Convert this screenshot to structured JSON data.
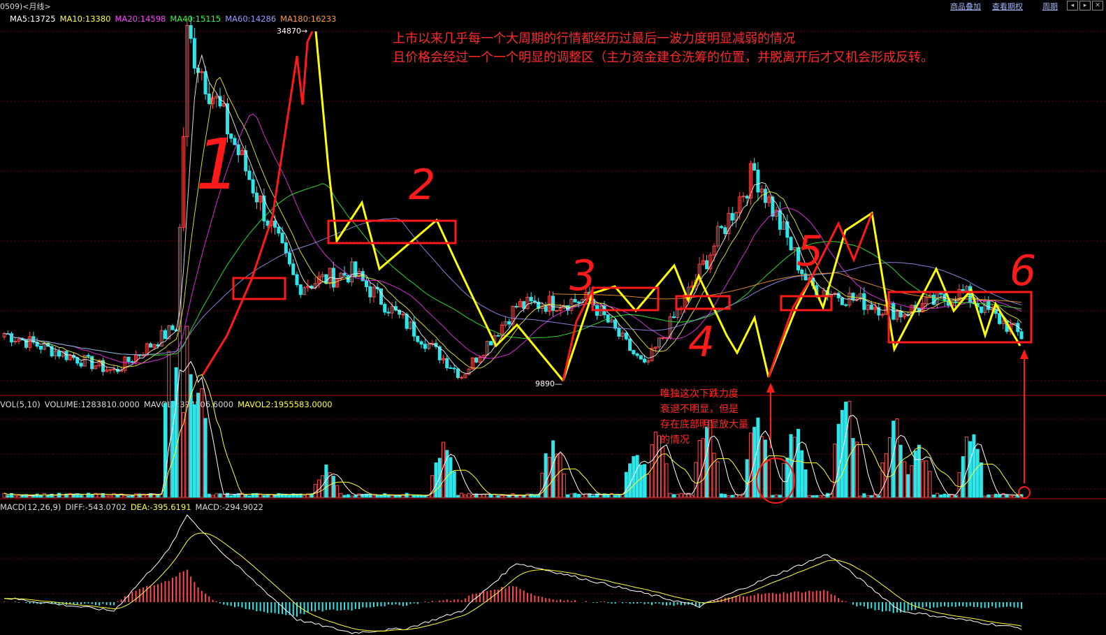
{
  "header": {
    "title": "0509)<月线>",
    "links": [
      "商品叠加",
      "查看期权",
      "周期"
    ]
  },
  "colors": {
    "up": "#ff4a4a",
    "down": "#2ee6ea",
    "ma5": "#ffffff",
    "ma10": "#ffff33",
    "ma20": "#ff33ff",
    "ma40": "#33ff33",
    "ma60": "#9a9aff",
    "ma180": "#ff9a33",
    "annot_red": "#ff1a1a",
    "annot_yellow": "#ffff00",
    "grid": "#6a0000"
  },
  "legend_main": [
    {
      "text": "MA5:13725",
      "color": "#ffffff"
    },
    {
      "text": "MA10:13380",
      "color": "#ffff33"
    },
    {
      "text": "MA20:14598",
      "color": "#ff44ff"
    },
    {
      "text": "MA40:15115",
      "color": "#33ff33"
    },
    {
      "text": "MA60:14286",
      "color": "#9a9aff"
    },
    {
      "text": "MA180:16233",
      "color": "#ff9a33"
    }
  ],
  "legend_vol": [
    {
      "text": "VOL(5,10)",
      "color": "#d8d8d8"
    },
    {
      "text": "VOLUME:1283810.0000",
      "color": "#d8d8d8"
    },
    {
      "text": "MAVOL1:394506.6000",
      "color": "#d8d8d8"
    },
    {
      "text": "MAVOL2:1955583.0000",
      "color": "#ffff33"
    }
  ],
  "legend_macd": [
    {
      "text": "MACD(12,26,9)",
      "color": "#d8d8d8"
    },
    {
      "text": "DIFF:-543.0702",
      "color": "#d8d8d8"
    },
    {
      "text": "DEA:-395.6191",
      "color": "#ffff33"
    },
    {
      "text": "MACD:-294.9022",
      "color": "#d8d8d8"
    }
  ],
  "annotations": {
    "note_main_1": "上市以来几乎每一个大周期的行情都经历过最后一波力度明显减弱的情况",
    "note_main_2": "且价格会经过一个一个明显的调整区（主力资金建仓洗筹的位置，并脱离开后才又机会形成反转。",
    "note_side": [
      "唯独这次下跌力度",
      "衰退不明显，但是",
      "存在底部明显放大量",
      "的情况"
    ],
    "numbers": [
      "1",
      "2",
      "3",
      "4",
      "5",
      "6"
    ]
  },
  "chart_data": {
    "type": "candlestick",
    "price_marks": {
      "high_label": "34870",
      "low_label": "9890"
    },
    "price_anchors": {
      "period_index": [
        0,
        30,
        47,
        50,
        80,
        95,
        125,
        140,
        160,
        175,
        185,
        205,
        220,
        245,
        262,
        278
      ],
      "close": [
        13000,
        10200,
        13500,
        34870,
        16500,
        17500,
        9890,
        15000,
        15500,
        10500,
        15000,
        25000,
        16500,
        14500,
        16000,
        12800
      ]
    },
    "vol_spikes": [
      {
        "at": 47,
        "h": 300
      },
      {
        "at": 50,
        "h": 420
      },
      {
        "at": 52,
        "h": 350
      },
      {
        "at": 88,
        "h": 50
      },
      {
        "at": 120,
        "h": 90
      },
      {
        "at": 150,
        "h": 100
      },
      {
        "at": 173,
        "h": 80
      },
      {
        "at": 178,
        "h": 120
      },
      {
        "at": 192,
        "h": 140
      },
      {
        "at": 206,
        "h": 150
      },
      {
        "at": 216,
        "h": 120
      },
      {
        "at": 230,
        "h": 180
      },
      {
        "at": 243,
        "h": 140
      },
      {
        "at": 250,
        "h": 90
      },
      {
        "at": 264,
        "h": 110
      }
    ],
    "macd_anchors": {
      "period_index": [
        0,
        30,
        45,
        50,
        60,
        80,
        95,
        110,
        125,
        140,
        165,
        190,
        210,
        225,
        245,
        278
      ],
      "diff": [
        0.05,
        -0.1,
        0.6,
        1.0,
        0.55,
        -0.2,
        -0.35,
        -0.3,
        -0.1,
        0.45,
        0.2,
        -0.05,
        0.3,
        0.55,
        -0.1,
        -0.3
      ]
    }
  }
}
